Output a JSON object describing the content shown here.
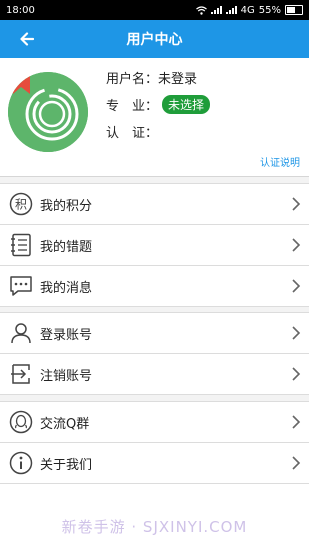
{
  "status_bar": {
    "time": "18:00",
    "network": "4G",
    "battery": "55%",
    "battery_level": 0.55
  },
  "header": {
    "title": "用户中心",
    "back_icon": "arrow-left-icon"
  },
  "profile": {
    "username_label": "用户名：",
    "username_value": "未登录",
    "major_label": "专　业：",
    "major_value": "未选择",
    "cert_label": "认　证：",
    "cert_link": "认证说明",
    "colors": {
      "avatar_bg": "#5db56b",
      "major_badge": "#1f9d3a"
    }
  },
  "menu_group_1": [
    {
      "label": "我的积分",
      "icon": "points-icon"
    },
    {
      "label": "我的错题",
      "icon": "notebook-icon"
    },
    {
      "label": "我的消息",
      "icon": "message-icon"
    }
  ],
  "menu_group_2": [
    {
      "label": "登录账号",
      "icon": "user-icon"
    },
    {
      "label": "注销账号",
      "icon": "logout-icon"
    }
  ],
  "menu_group_3": [
    {
      "label": "交流Q群",
      "icon": "qq-icon"
    },
    {
      "label": "关于我们",
      "icon": "info-icon"
    }
  ],
  "watermark": "新卷手游 · SJXINYI.COM",
  "theme": {
    "accent": "#1e96e6"
  }
}
